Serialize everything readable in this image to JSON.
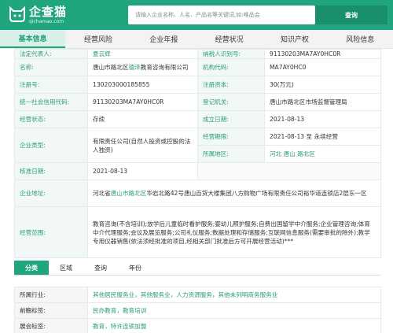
{
  "brand": {
    "name": "企查猫",
    "domain": "qichamao.com",
    "color": "#20a67f"
  },
  "search": {
    "placeholder": "请输入企业名称、人名、产品名等关键词,如:唯品会",
    "button_label": "查询"
  },
  "tabs": [
    "基本信息",
    "经营风险",
    "企业年报",
    "经营状况",
    "知识产权",
    "风险信息"
  ],
  "info": {
    "legal_rep_label": "法定代表人:",
    "legal_rep_value": "夏云辉",
    "tax_id_label": "纳税人识别号:",
    "tax_id_value": "91130203MA7AY0HC0R",
    "name_label": "名称:",
    "name_pre": "唐山市路北区",
    "name_hl": "德泽",
    "name_post": "教育咨询有限公司",
    "org_code_label": "机构代码:",
    "org_code_value": "MA7AY0HC0",
    "reg_no_label": "注册号:",
    "reg_no_value": "130203000185855",
    "reg_capital_label": "注册资本:",
    "reg_capital_value": "30(万元)",
    "credit_code_label": "统一社会信用代码:",
    "credit_code_value": "91130203MA7AY0HC0R",
    "reg_authority_label": "登记机关:",
    "reg_authority_value": "唐山市路北区市场监督管理局",
    "status_label": "经营状态:",
    "status_value": "存续",
    "founded_label": "成立日期:",
    "founded_value": "2021-08-13",
    "type_label": "企业类型:",
    "type_value": "有限责任公司(自然人投资或控股的法人独资)",
    "term_label": "经营期限:",
    "term_value": "2021-08-13 至 永续经营",
    "region_label": "所属地区:",
    "region_value": "河北 唐山 路北区",
    "approved_label": "核准日期:",
    "approved_value": "2021-08-13",
    "address_label": "企业地址:",
    "address_pre": "河北省",
    "address_link": "唐山市路北区",
    "address_post": "华岩北路42号唐山百货大楼集团八方购物广场有限责任公司裕华道连锁店2层东一区",
    "scope_label": "经营范围:",
    "scope_value": "教育咨询(不含培训);放学后儿童临时看护服务;婴幼儿照护服务;自费出国留学中介服务;企业管理咨询;体育中介代理服务;会议及展览服务;公司礼仪服务;数据处理和存储服务;互联网信息服务(需要审批的除外);教学专用仪器销售(依法须经批准的项目,经相关部门批准后方可开展经营活动)***"
  },
  "sub_tabs": [
    "分类",
    "区域",
    "查询",
    "年份"
  ],
  "categories": {
    "industry_label": "所属行业:",
    "industry_items": [
      "其他居民服务业",
      "其他服务业",
      "人力资源服务",
      "其他未列明商务服务业"
    ],
    "front_label": "前瞻标签:",
    "front_items": [
      "民办教育",
      "教育培训"
    ],
    "expo_label": "展会标签:",
    "expo_items": [
      "教育",
      "特许连锁加盟"
    ]
  }
}
